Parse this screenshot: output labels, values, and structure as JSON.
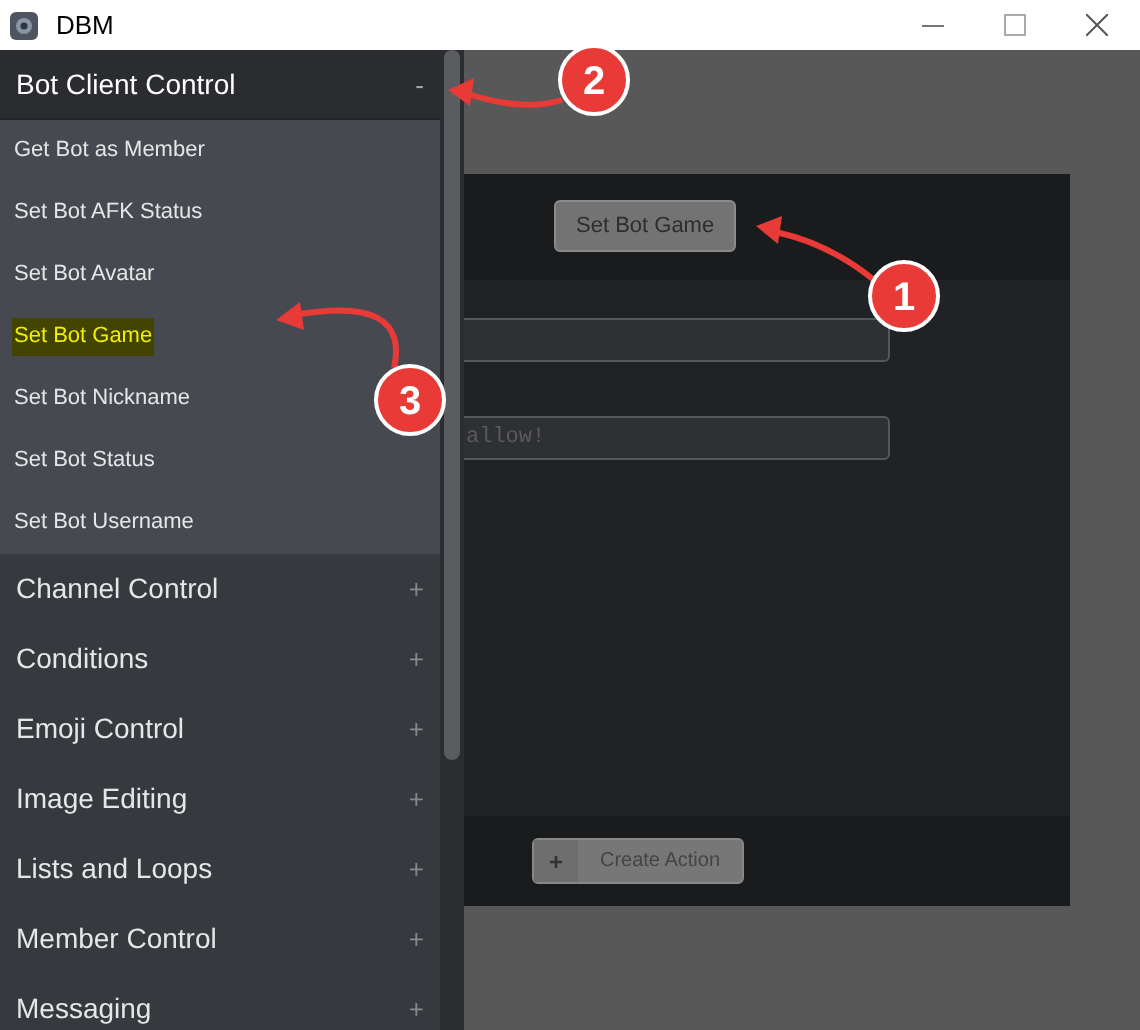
{
  "window": {
    "title": "DBM"
  },
  "sidebar": {
    "groups": [
      {
        "label": "Bot Client Control",
        "toggle": "-",
        "expanded": true,
        "items": [
          {
            "label": "Get Bot as Member",
            "selected": false
          },
          {
            "label": "Set Bot AFK Status",
            "selected": false
          },
          {
            "label": "Set Bot Avatar",
            "selected": false
          },
          {
            "label": "Set Bot Game",
            "selected": true
          },
          {
            "label": "Set Bot Nickname",
            "selected": false
          },
          {
            "label": "Set Bot Status",
            "selected": false
          },
          {
            "label": "Set Bot Username",
            "selected": false
          }
        ]
      },
      {
        "label": "Channel Control",
        "toggle": "+",
        "expanded": false
      },
      {
        "label": "Conditions",
        "toggle": "+",
        "expanded": false
      },
      {
        "label": "Emoji Control",
        "toggle": "+",
        "expanded": false
      },
      {
        "label": "Image Editing",
        "toggle": "+",
        "expanded": false
      },
      {
        "label": "Lists and Loops",
        "toggle": "+",
        "expanded": false
      },
      {
        "label": "Member Control",
        "toggle": "+",
        "expanded": false
      },
      {
        "label": "Messaging",
        "toggle": "+",
        "expanded": false
      }
    ]
  },
  "dialog": {
    "action_button": "Set Bot Game",
    "fields": [
      {
        "kind": "text"
      },
      {
        "kind": "text",
        "placeholder": "allow!"
      }
    ],
    "create_button": {
      "icon": "+",
      "label": "Create Action"
    }
  },
  "annotations": [
    {
      "label": "1"
    },
    {
      "label": "2"
    },
    {
      "label": "3"
    }
  ]
}
